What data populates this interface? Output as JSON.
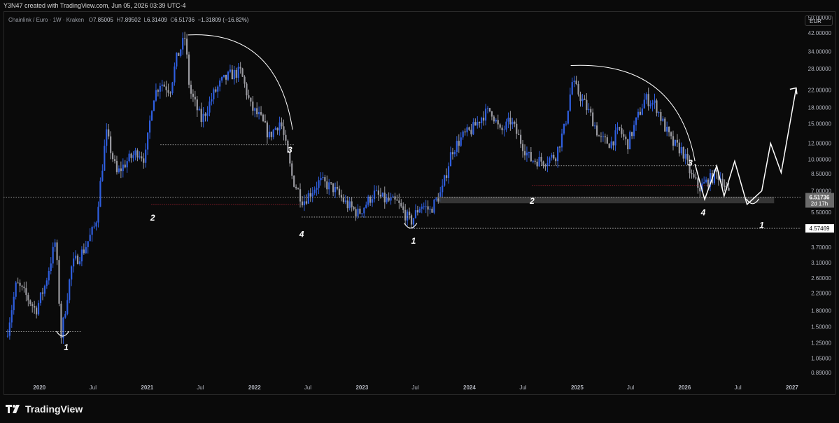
{
  "header": {
    "credit": "Y3N47 created with TradingView.com, Jun 05, 2026 03:39 UTC-4"
  },
  "symbol": {
    "name": "Chainlink / Euro · 1W · Kraken",
    "open_label": "O",
    "open": "7.85005",
    "high_label": "H",
    "high": "7.89502",
    "low_label": "L",
    "low": "6.31409",
    "close_label": "C",
    "close": "6.51736",
    "change": "−1.31809 (−16.82%)"
  },
  "currency_badge": "EUR",
  "footer": {
    "brand": "TradingView"
  },
  "colors": {
    "background": "#0a0a0a",
    "candle_up": "#2f5fe0",
    "candle_down": "#9a9aa0",
    "price_badge": "#6b6b6b",
    "annotation": "#ffffff",
    "support_line": "#8a1e2a"
  },
  "chart_data": {
    "type": "candlestick",
    "scale": "log",
    "ylim": [
      0.85,
      52
    ],
    "y_ticks": [
      "50.00000",
      "42.00000",
      "34.00000",
      "28.00000",
      "22.00000",
      "18.00000",
      "15.00000",
      "12.00000",
      "10.00000",
      "8.50000",
      "7.00000",
      "5.50000",
      "4.50000",
      "3.70000",
      "3.10000",
      "2.60000",
      "2.20000",
      "1.80000",
      "1.50000",
      "1.25000",
      "1.05000",
      "0.89000"
    ],
    "x_ticks": [
      "2020",
      "Jul",
      "2021",
      "Jul",
      "2022",
      "Jul",
      "2023",
      "Jul",
      "2024",
      "Jul",
      "2025",
      "Jul",
      "2026",
      "Jul",
      "2027"
    ],
    "x_tick_dates": [
      "2020-01-01",
      "2020-07-01",
      "2021-01-01",
      "2021-07-01",
      "2022-01-01",
      "2022-07-01",
      "2023-01-01",
      "2023-07-01",
      "2024-01-01",
      "2024-07-01",
      "2025-01-01",
      "2025-07-01",
      "2026-01-01",
      "2026-07-01",
      "2027-01-01"
    ],
    "xlim": [
      "2019-09-01",
      "2027-02-01"
    ],
    "price_badge": {
      "value": 6.51736,
      "label": "6.51736",
      "countdown": "2d 17h"
    },
    "level_badge": {
      "value": 4.57469,
      "label": "4.57469"
    },
    "price_path": [
      [
        "2019-09-15",
        1.45
      ],
      [
        "2019-10-15",
        2.45
      ],
      [
        "2019-11-20",
        2.1
      ],
      [
        "2019-12-20",
        1.8
      ],
      [
        "2020-01-20",
        2.4
      ],
      [
        "2020-02-25",
        4.0
      ],
      [
        "2020-03-15",
        1.35
      ],
      [
        "2020-04-20",
        3.0
      ],
      [
        "2020-06-01",
        3.6
      ],
      [
        "2020-07-10",
        4.8
      ],
      [
        "2020-08-15",
        13.5
      ],
      [
        "2020-09-20",
        8.5
      ],
      [
        "2020-10-25",
        9.8
      ],
      [
        "2020-12-01",
        11.0
      ],
      [
        "2020-12-25",
        10.0
      ],
      [
        "2021-01-20",
        20.0
      ],
      [
        "2021-02-15",
        24.0
      ],
      [
        "2021-03-20",
        22.0
      ],
      [
        "2021-04-10",
        31.0
      ],
      [
        "2021-05-10",
        40.0
      ],
      [
        "2021-05-25",
        22.0
      ],
      [
        "2021-07-05",
        15.5
      ],
      [
        "2021-08-15",
        21.0
      ],
      [
        "2021-09-10",
        24.0
      ],
      [
        "2021-10-10",
        26.0
      ],
      [
        "2021-11-15",
        27.0
      ],
      [
        "2021-12-20",
        18.0
      ],
      [
        "2022-01-20",
        16.0
      ],
      [
        "2022-02-20",
        13.0
      ],
      [
        "2022-03-30",
        15.5
      ],
      [
        "2022-05-10",
        8.0
      ],
      [
        "2022-06-15",
        6.2
      ],
      [
        "2022-08-10",
        7.8
      ],
      [
        "2022-09-25",
        7.2
      ],
      [
        "2022-11-10",
        6.0
      ],
      [
        "2022-12-20",
        5.4
      ],
      [
        "2023-02-10",
        6.8
      ],
      [
        "2023-03-20",
        6.3
      ],
      [
        "2023-05-01",
        6.1
      ],
      [
        "2023-06-15",
        4.9
      ],
      [
        "2023-07-20",
        6.0
      ],
      [
        "2023-08-20",
        5.6
      ],
      [
        "2023-09-30",
        7.0
      ],
      [
        "2023-11-01",
        11.0
      ],
      [
        "2023-12-10",
        13.0
      ],
      [
        "2024-01-10",
        14.0
      ],
      [
        "2024-02-15",
        16.5
      ],
      [
        "2024-03-15",
        17.5
      ],
      [
        "2024-04-15",
        13.5
      ],
      [
        "2024-05-20",
        15.5
      ],
      [
        "2024-06-20",
        12.5
      ],
      [
        "2024-07-25",
        10.0
      ],
      [
        "2024-09-10",
        9.8
      ],
      [
        "2024-10-20",
        10.5
      ],
      [
        "2024-11-20",
        14.5
      ],
      [
        "2024-12-15",
        24.0
      ],
      [
        "2025-01-15",
        20.0
      ],
      [
        "2025-02-20",
        16.0
      ],
      [
        "2025-03-20",
        12.5
      ],
      [
        "2025-04-25",
        12.0
      ],
      [
        "2025-05-25",
        14.0
      ],
      [
        "2025-06-20",
        11.8
      ],
      [
        "2025-07-25",
        16.0
      ],
      [
        "2025-08-20",
        20.0
      ],
      [
        "2025-09-25",
        18.5
      ],
      [
        "2025-10-20",
        15.0
      ],
      [
        "2025-11-20",
        12.0
      ],
      [
        "2025-12-25",
        11.0
      ],
      [
        "2026-01-25",
        8.2
      ],
      [
        "2026-02-20",
        7.2
      ],
      [
        "2026-03-20",
        7.8
      ],
      [
        "2026-04-20",
        8.5
      ],
      [
        "2026-05-10",
        7.9
      ],
      [
        "2026-06-02",
        6.52
      ]
    ]
  },
  "annotations": {
    "wave_labels": [
      {
        "text": "1",
        "date": "2020-04-01",
        "price": 1.15
      },
      {
        "text": "2",
        "date": "2021-01-20",
        "price": 5.0
      },
      {
        "text": "3",
        "date": "2022-05-01",
        "price": 10.8
      },
      {
        "text": "4",
        "date": "2022-06-10",
        "price": 4.15
      },
      {
        "text": "1",
        "date": "2023-06-25",
        "price": 3.85
      },
      {
        "text": "2",
        "date": "2024-08-01",
        "price": 6.05
      },
      {
        "text": "3",
        "date": "2026-01-20",
        "price": 9.3
      },
      {
        "text": "4",
        "date": "2026-03-05",
        "price": 5.3
      },
      {
        "text": "1",
        "date": "2026-09-20",
        "price": 4.6
      }
    ],
    "projection_path": [
      [
        "2026-02-05",
        9.5
      ],
      [
        "2026-03-10",
        6.35
      ],
      [
        "2026-04-20",
        9.3
      ],
      [
        "2026-05-15",
        6.6
      ],
      [
        "2026-06-20",
        9.8
      ],
      [
        "2026-08-01",
        6.0
      ],
      [
        "2026-09-20",
        7.0
      ],
      [
        "2026-10-20",
        12.0
      ],
      [
        "2026-11-25",
        8.6
      ],
      [
        "2027-01-15",
        22.5
      ]
    ],
    "projection_arrow_tip": [
      "2027-01-15",
      22.5
    ],
    "arcs": [
      {
        "from": [
          "2021-05-20",
          41.0
        ],
        "to": [
          "2022-05-10",
          14.0
        ]
      },
      {
        "from": [
          "2024-12-10",
          29.0
        ],
        "to": [
          "2026-02-05",
          9.8
        ]
      }
    ],
    "bottom_smiles": [
      {
        "date": "2020-03-20",
        "price": 1.38
      },
      {
        "date": "2023-06-15",
        "price": 4.7
      },
      {
        "date": "2026-08-20",
        "price": 6.2
      }
    ],
    "dotted_levels": [
      {
        "from": "2019-09-10",
        "to": "2020-05-20",
        "price": 1.42
      },
      {
        "from": "2021-02-15",
        "to": "2022-05-15",
        "price": 11.8
      },
      {
        "from": "2022-06-10",
        "to": "2023-06-20",
        "price": 5.2
      },
      {
        "from": "2023-06-10",
        "to": "2027-02-01",
        "price": 4.57469
      },
      {
        "from": "2024-09-01",
        "to": "2026-04-20",
        "price": 9.3
      },
      {
        "from": "2019-09-01",
        "to": "2027-02-01",
        "price": 6.51736
      }
    ],
    "red_levels": [
      {
        "from": "2021-01-15",
        "to": "2022-06-01",
        "price": 6.0
      },
      {
        "from": "2024-08-01",
        "to": "2026-03-20",
        "price": 7.45
      }
    ],
    "gray_band": {
      "from": "2023-09-20",
      "to": "2026-11-01",
      "low": 6.08,
      "high": 6.55
    }
  }
}
